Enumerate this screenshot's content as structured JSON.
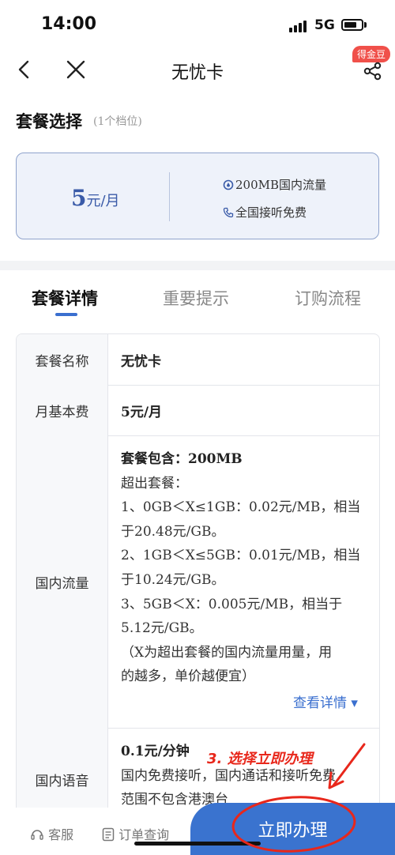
{
  "status_bar": {
    "time": "14:00",
    "network": "5G"
  },
  "nav": {
    "title": "无忧卡",
    "badge": "得金豆"
  },
  "plan_select": {
    "title": "套餐选择",
    "subtitle": "(1个档位)",
    "card": {
      "price_number": "5",
      "price_unit": "元/月",
      "features": [
        "200MB国内流量",
        "全国接听免费"
      ]
    }
  },
  "tabs": [
    {
      "label": "套餐详情",
      "active": true
    },
    {
      "label": "重要提示",
      "active": false
    },
    {
      "label": "订购流程",
      "active": false
    }
  ],
  "details": {
    "rows": [
      {
        "label": "套餐名称",
        "value": "无忧卡"
      },
      {
        "label": "月基本费",
        "value": "5元/月"
      },
      {
        "label": "国内流量",
        "lines": [
          "套餐包含：200MB",
          "超出套餐：",
          "1、0GB＜X≤1GB：0.02元/MB，相当",
          "于20.48元/GB。",
          "2、1GB＜X≤5GB：0.01元/MB，相当",
          "于10.24元/GB。",
          "3、5GB＜X：0.005元/MB，相当于",
          "5.12元/GB。",
          "（X为超出套餐的国内流量用量，用",
          "的越多，单价越便宜）"
        ],
        "more_label": "查看详情 ▾"
      },
      {
        "label": "国内语音",
        "lines": [
          "0.1元/分钟",
          "国内免费接听，国内通话和接听免费",
          "范围不包含港澳台"
        ]
      }
    ]
  },
  "bottom_bar": {
    "service_label": "客服",
    "orders_label": "订单查询",
    "apply_label": "立即办理"
  },
  "annotation": {
    "text": "3. 选择立即办理",
    "color": "#e8271b"
  },
  "colors": {
    "accent": "#3a73cf",
    "badge": "#f0504a",
    "card_border": "#8fa3cc"
  }
}
